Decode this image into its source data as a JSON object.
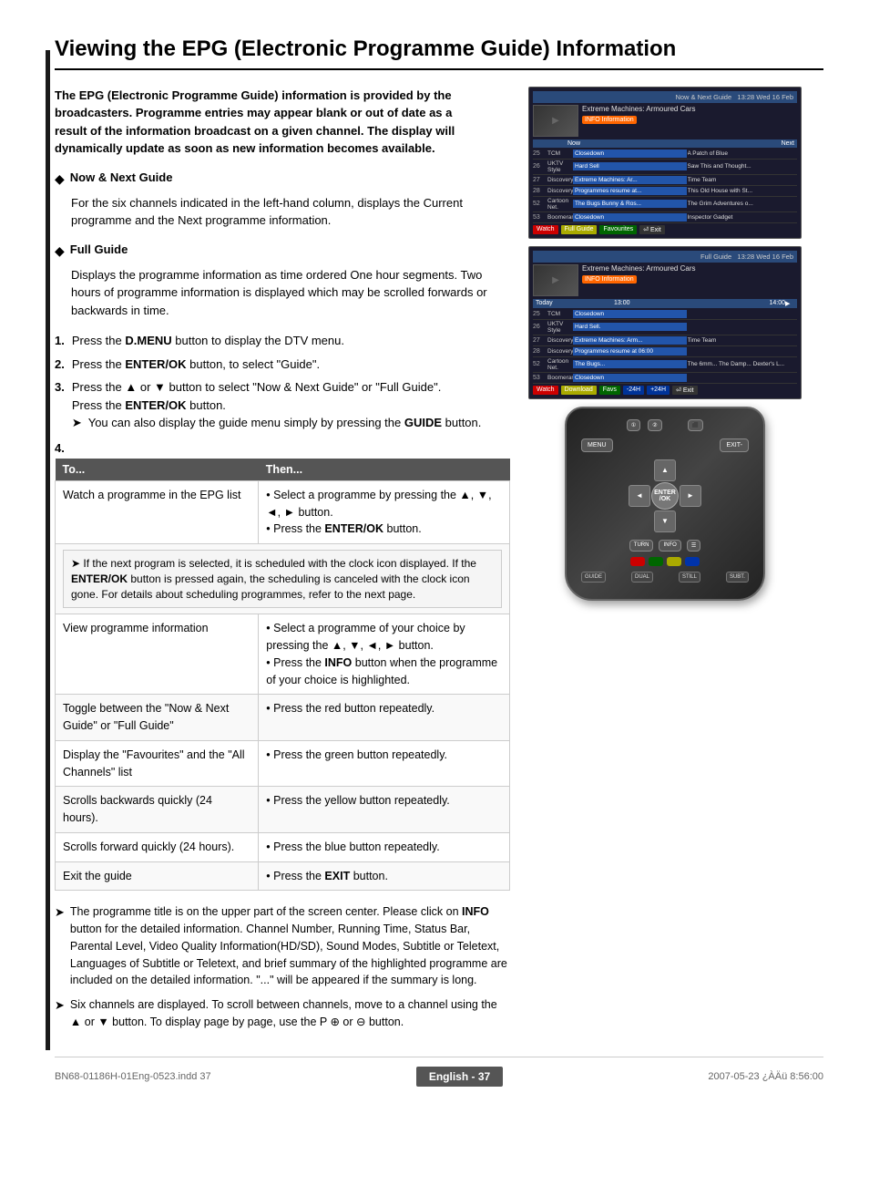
{
  "page": {
    "title": "Viewing the EPG (Electronic Programme Guide) Information",
    "intro": "The EPG (Electronic Programme Guide) information is provided by the broadcasters. Programme entries may appear blank or out of date as a result of the information broadcast on a given channel. The display will dynamically update as soon as new information becomes available.",
    "sections": [
      {
        "id": "now-next",
        "title": "Now & Next Guide",
        "body": "For the six channels indicated in the left-hand column, displays the Current programme and the Next programme information."
      },
      {
        "id": "full-guide",
        "title": "Full Guide",
        "body": "Displays the programme information as time ordered One hour segments. Two hours of programme information is displayed which may be scrolled forwards or backwards in time."
      }
    ],
    "steps": [
      {
        "num": "1.",
        "text": "Press the D.MENU button to display the DTV menu."
      },
      {
        "num": "2.",
        "text": "Press the ENTER/OK button, to select \"Guide\"."
      },
      {
        "num": "3.",
        "text": "Press the ▲ or ▼ button to select \"Now & Next Guide\" or \"Full Guide\".\nPress the ENTER/OK button.\n➤  You can also display the guide menu simply by pressing the GUIDE button."
      }
    ],
    "step4_label": "4.",
    "table_headers": [
      "To...",
      "Then..."
    ],
    "table_rows": [
      {
        "to": "Watch a programme in the EPG list",
        "then": "• Select a programme by pressing the ▲, ▼, ◄, ► button.\n• Press the ENTER/OK button."
      },
      {
        "to": "View programme information",
        "then": "• Select a programme of your choice by pressing the ▲, ▼, ◄, ► button.\n• Press the INFO button when the programme of your choice is highlighted."
      },
      {
        "to": "Toggle between the \"Now & Next Guide\" or \"Full Guide\"",
        "then": "• Press the red button repeatedly."
      },
      {
        "to": "Display the \"Favourites\" and the \"All Channels\" list",
        "then": "• Press the green button repeatedly."
      },
      {
        "to": "Scrolls backwards quickly (24 hours).",
        "then": "• Press the yellow button repeatedly."
      },
      {
        "to": "Scrolls forward quickly (24 hours).",
        "then": "• Press the blue button repeatedly."
      },
      {
        "to": "Exit the guide",
        "then": "• Press the EXIT button."
      }
    ],
    "note_box": "If the next program is selected, it is scheduled with the clock icon displayed. If the ENTER/OK button is pressed again, the scheduling is canceled with the clock icon gone. For details about scheduling programmes, refer to the next page.",
    "bottom_notes": [
      "The programme title is on the upper part of the screen center. Please click on INFO button for the detailed information. Channel Number, Running Time, Status Bar, Parental Level, Video Quality Information(HD/SD), Sound Modes, Subtitle or Teletext, Languages of Subtitle or Teletext, and brief summary of the highlighted programme are included on the detailed information. \"...\" will be appeared if the summary is long.",
      "Six channels are displayed. To scroll between channels, move to a channel using the ▲ or ▼ button. To display page by page, use the P ⊕ or ⊖ button."
    ],
    "footer": {
      "language": "English",
      "page_label": "English - 37",
      "file_info": "BN68-01186H-01Eng-0523.indd   37",
      "date_info": "2007-05-23   ¿ÀÄü 8:56:00"
    },
    "epg_screens": {
      "now_next": {
        "title_bar": "Now & Next Guide",
        "date": "13:28 Wed 16 Feb",
        "prog_title": "Extreme Machines: Armoured Cars",
        "info_label": "INFO Information",
        "now_label": "Now",
        "next_label": "Next",
        "channels": [
          {
            "num": "25",
            "name": "TCM",
            "now": "Closedown",
            "next": "A Patch of Blue"
          },
          {
            "num": "26",
            "name": "UKTV Style",
            "now": "Hard Sell",
            "next": "Saw This and Thought..."
          },
          {
            "num": "27",
            "name": "Discovery",
            "now": "Extreme Machines: Ar...",
            "next": "Time Team"
          },
          {
            "num": "28",
            "name": "DiscoveryH.",
            "now": "Programmes resume at...",
            "next": "This Old House with St..."
          },
          {
            "num": "52",
            "name": "Cartoon Net.",
            "now": "The Bugs Bunny & Ros...",
            "next": "The Grim Adventures o..."
          },
          {
            "num": "53",
            "name": "Boomerang",
            "now": "Closedown",
            "next": "Inspector Gadget"
          }
        ],
        "footer_buttons": [
          "Watch",
          "Full Guide",
          "Favourites",
          "Exit"
        ]
      },
      "full_guide": {
        "title_bar": "Full Guide",
        "date": "13:28 Wed 16 Feb",
        "prog_title": "Extreme Machines: Armoured Cars",
        "info_label": "INFO Information",
        "today_label": "Today",
        "time1": "13:00",
        "time2": "14:00",
        "channels": [
          {
            "num": "25",
            "name": "TCM",
            "now": "Closedown",
            "next": ""
          },
          {
            "num": "26",
            "name": "UKTV Style",
            "now": "Hard Sell.",
            "next": ""
          },
          {
            "num": "27",
            "name": "Discovery",
            "now": "Extreme Machines: Arm...",
            "next": "Time Team"
          },
          {
            "num": "28",
            "name": "DiscoveryH.",
            "now": "Programmes resume at 06:00",
            "next": ""
          },
          {
            "num": "52",
            "name": "Cartoon Net.",
            "now": "The Bugs...",
            "next": "The 6mm...   The Damp...   Dexter's L..."
          },
          {
            "num": "53",
            "name": "Boomerang",
            "now": "Closedown",
            "next": ""
          }
        ],
        "footer_buttons": [
          "Watch",
          "Download",
          "Favourites",
          "-24Hours",
          "+24Hours",
          "Exit"
        ]
      }
    },
    "remote": {
      "menu_label": "MENU",
      "exit_label": "EXIT-",
      "enter_label": "ENTER\n/OK",
      "turn_label": "TURN",
      "info_label": "INFO",
      "guide_label": "GUIDE",
      "dual_label": "DUAL",
      "still_label": "STILL",
      "subt_label": "SUBT."
    }
  }
}
